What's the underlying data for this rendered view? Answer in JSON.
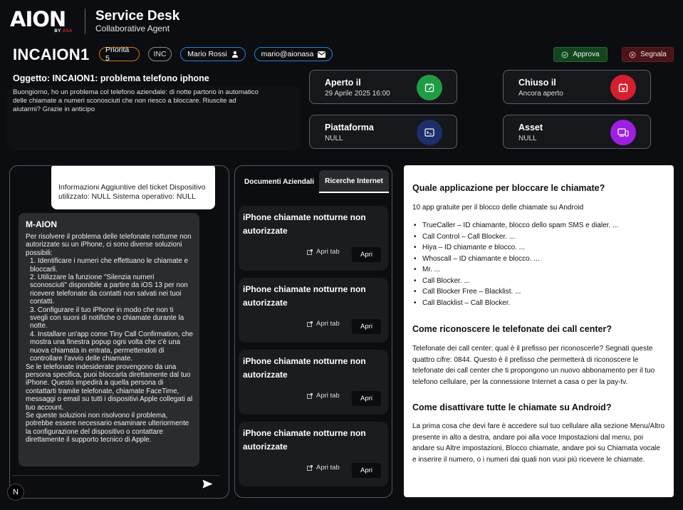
{
  "header": {
    "logo_text": "AION",
    "logo_by": "BY",
    "logo_brand": "ASA",
    "title": "Service Desk",
    "subtitle": "Collaborative Agent"
  },
  "ticket": {
    "id": "INCAION1",
    "priority": "Priorità 5",
    "type": "INC",
    "user": "Mario Rossi",
    "email": "mario@aionasa",
    "approve_label": "Approva",
    "report_label": "Segnala",
    "subject": "Oggetto: INCAION1:  problema telefono iphone",
    "description": "Buongiorno, ho un problema col telefono aziendale: di notte partono in automatico delle chiamate a numeri sconosciuti che non riesco a bloccare. Riuscite ad aiutarmi? Grazie in anticipo"
  },
  "info_cards": {
    "opened": {
      "title": "Aperto il",
      "value": "29 Aprile 2025 16:00",
      "color": "#1f9d45"
    },
    "closed": {
      "title": "Chiuso il",
      "value": "Ancora aperto",
      "color": "#d3202f"
    },
    "platform": {
      "title": "Piattaforma",
      "value": "NULL",
      "color": "#1c2f6b"
    },
    "asset": {
      "title": "Asset",
      "value": "NULL",
      "color": "#9b20e0"
    }
  },
  "chat": {
    "user_message": "Informazioni Aggiuntive del ticket Dispositivo utilizzato: NULL Sistema operativo: NULL",
    "bot_name": "M-AION",
    "bot_lines": [
      "Per risolvere il problema delle telefonate notturne non autorizzate su un iPhone, ci sono diverse soluzioni possibili:",
      "1. Identificare i numeri che effettuano le chiamate e bloccarli.",
      "2. Utilizzare la funzione \"Silenzia numeri sconosciuti\" disponibile a partire da iOS 13 per non ricevere telefonate da contatti non salvati nei tuoi contatti.",
      "3. Configurare il tuo iPhone in modo che non ti svegli con suoni di notifiche o chiamate durante la notte.",
      "4. Installare un'app come Tiny Call Confirmation, che mostra una finestra popup ogni volta che c'è una nuova chiamata in entrata, permettendoti di controllare l'avvio delle chiamate.",
      "Se le telefonate indesiderate provengono da una persona specifica, puoi bloccarla direttamente dal tuo iPhone. Questo impedirà a quella persona di contattarti tramite telefonate, chiamate FaceTime, messaggi o email su tutti i dispositivi Apple collegati al tuo account.",
      "Se queste soluzioni non risolvono il problema, potrebbe essere necessario esaminare ulteriormente la configurazione del dispositivo o contattare direttamente il supporto tecnico di Apple."
    ],
    "n_badge": "N"
  },
  "docs": {
    "tab_docs": "Documenti Aziendali",
    "tab_web": "Ricerche Internet",
    "results": [
      {
        "title": "iPhone chiamate notturne non autorizzate",
        "tab_label": "Apri tab",
        "open_label": "Apri"
      },
      {
        "title": "iPhone chiamate notturne non autorizzate",
        "tab_label": "Apri tab",
        "open_label": "Apri"
      },
      {
        "title": "iPhone chiamate notturne non autorizzate",
        "tab_label": "Apri tab",
        "open_label": "Apri"
      },
      {
        "title": "iPhone chiamate notturne non autorizzate",
        "tab_label": "Apri tab",
        "open_label": "Apri"
      }
    ]
  },
  "content": {
    "h1": "Quale applicazione per bloccare le chiamate?",
    "p1": "10 app gratuite per il blocco delle chiamate su Android",
    "list": [
      "TrueCaller – ID chiamante, blocco dello spam SMS e dialer. ...",
      "Call Control – Call Blocker. ...",
      "Hiya – ID chiamante e blocco. ...",
      "Whoscall – ID chiamante e blocco. ...",
      "Mr. ...",
      "Call Blocker. ...",
      "Call Blocker Free – Blacklist. ...",
      "Call Blacklist – Call Blocker."
    ],
    "h2": "Come riconoscere le telefonate dei call center?",
    "p2": "Telefonate dei call center: qual è il prefisso per riconoscerle? Segnati queste quattro cifre: 0844. Questo è il prefisso che permetterà di riconoscere le telefonate dei call center che ti propongono un nuovo abbonamento per il tuo telefono cellulare, per la connessione Internet a casa o per la pay-tv.",
    "h3": "Come disattivare tutte le chiamate su Android?",
    "p3": "La prima cosa che devi fare è accedere sul tuo cellulare alla sezione Menu/Altro presente in alto a destra, andare poi alla voce Impostazioni dal menu, poi andare su Altre impostazioni, Blocco chiamate, andare poi su Chiamata vocale e inserire il numero, o i numeri dai quali non vuoi più ricevere le chiamate."
  }
}
